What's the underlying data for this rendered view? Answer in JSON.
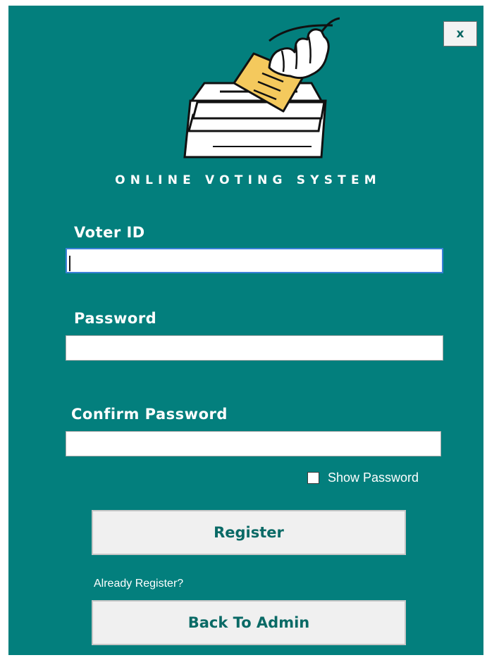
{
  "window": {
    "close_label": "x",
    "app_title": "ONLINE VOTING SYSTEM"
  },
  "form": {
    "voter_id": {
      "label": "Voter ID",
      "value": ""
    },
    "password": {
      "label": "Password",
      "value": ""
    },
    "confirm_password": {
      "label": "Confirm Password",
      "value": ""
    },
    "show_password": {
      "label": "Show Password",
      "checked": false
    }
  },
  "actions": {
    "register_label": "Register",
    "already_label": "Already Register?",
    "back_label": "Back To Admin"
  },
  "icons": {
    "logo": "ballot-box-icon",
    "close": "close-icon"
  },
  "colors": {
    "background": "#037f7d",
    "button_text": "#0a6a66",
    "ballot_paper": "#f4c95d",
    "focus_border": "#3b80d8"
  }
}
